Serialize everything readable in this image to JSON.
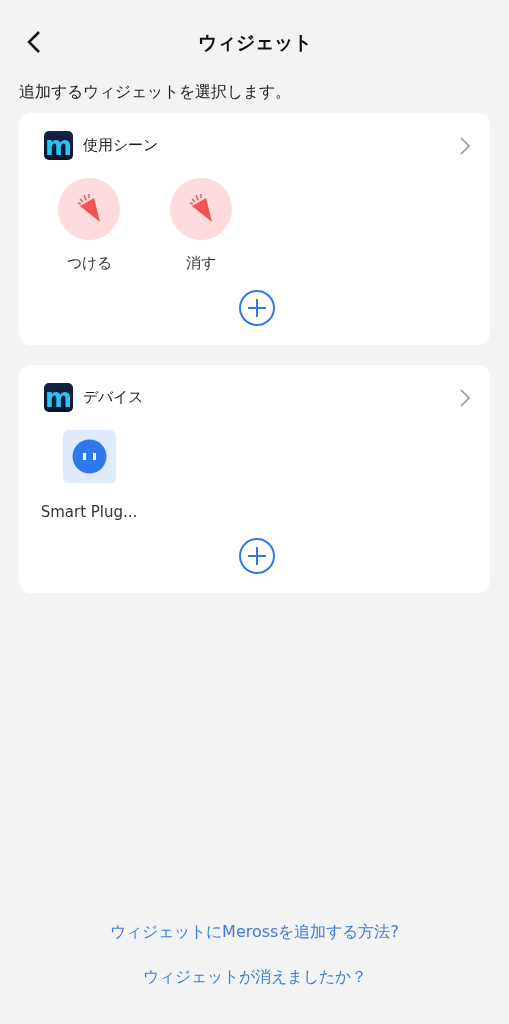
{
  "header": {
    "title": "ウィジェット"
  },
  "intro": "追加するウィジェットを選択します。",
  "sections": [
    {
      "logo": "m",
      "title": "使用シーン",
      "items": [
        {
          "kind": "scene",
          "label": "つける"
        },
        {
          "kind": "scene",
          "label": "消す"
        }
      ]
    },
    {
      "logo": "m",
      "title": "デバイス",
      "items": [
        {
          "kind": "device",
          "label": "Smart Plug..."
        }
      ]
    }
  ],
  "links": [
    "ウィジェットにMerossを追加する方法?",
    "ウィジェットが消えましたか？"
  ]
}
